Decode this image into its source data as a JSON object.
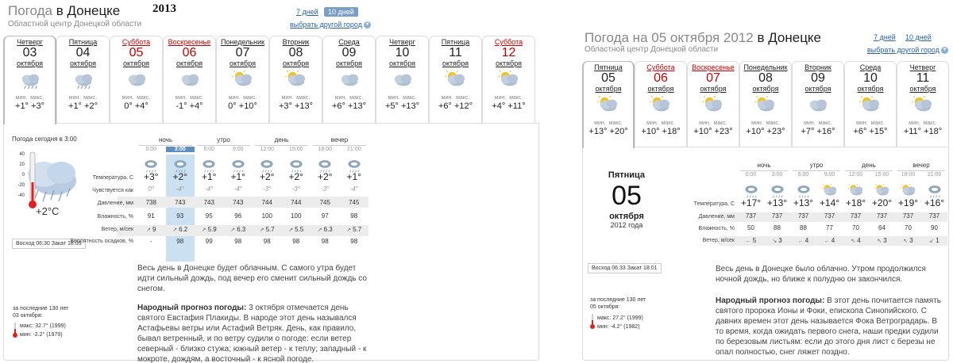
{
  "left": {
    "title_prefix": "Погода ",
    "title_city": "в Донецке",
    "year": "2013",
    "subtitle": "Областной центр Донецкой области",
    "period_7": "7 дней",
    "period_10": "10 дней",
    "other_city": "выбрать другой город",
    "min_label": "мин.",
    "max_label": "макс.",
    "days": [
      {
        "name": "Четверг",
        "num": "03",
        "month": "октября",
        "min": "+1°",
        "max": "+3°",
        "icon": "rain-cloud",
        "weekend": false,
        "selected": true
      },
      {
        "name": "Пятница",
        "num": "04",
        "month": "октября",
        "min": "+1°",
        "max": "+2°",
        "icon": "rain-cloud",
        "weekend": false,
        "selected": false
      },
      {
        "name": "Суббота",
        "num": "05",
        "month": "октября",
        "min": "0°",
        "max": "+4°",
        "icon": "cloud",
        "weekend": true,
        "selected": false
      },
      {
        "name": "Воскресенье",
        "num": "06",
        "month": "октября",
        "min": "-1°",
        "max": "+4°",
        "icon": "cloud",
        "weekend": true,
        "selected": false
      },
      {
        "name": "Понедельник",
        "num": "07",
        "month": "октября",
        "min": "0°",
        "max": "+10°",
        "icon": "sun-cloud",
        "weekend": false,
        "selected": false
      },
      {
        "name": "Вторник",
        "num": "08",
        "month": "октября",
        "min": "+3°",
        "max": "+13°",
        "icon": "sun-cloud",
        "weekend": false,
        "selected": false
      },
      {
        "name": "Среда",
        "num": "09",
        "month": "октября",
        "min": "+6°",
        "max": "+13°",
        "icon": "cloud",
        "weekend": false,
        "selected": false
      },
      {
        "name": "Четверг",
        "num": "10",
        "month": "октября",
        "min": "+5°",
        "max": "+13°",
        "icon": "cloud",
        "weekend": false,
        "selected": false
      },
      {
        "name": "Пятница",
        "num": "11",
        "month": "октября",
        "min": "+6°",
        "max": "+12°",
        "icon": "sun-cloud",
        "weekend": false,
        "selected": false
      },
      {
        "name": "Суббота",
        "num": "12",
        "month": "октября",
        "min": "+4°",
        "max": "+11°",
        "icon": "sun-cloud",
        "weekend": true,
        "selected": false
      }
    ],
    "today_label": "Погода сегодня в 3:00",
    "today_temp": "+2°С",
    "thermo_scale": [
      "40",
      "20",
      "0",
      "-20",
      "-40"
    ],
    "sunrise_label": "Восход",
    "sunrise": "06:30",
    "sunset_label": "Закат",
    "sunset": "18:05",
    "periods": [
      "ночь",
      "утро",
      "день",
      "вечер"
    ],
    "times": [
      "0:00",
      "3:00",
      "6:00",
      "9:00",
      "12:00",
      "15:00",
      "18:00",
      "21:00"
    ],
    "row_labels": [
      "Температура, С",
      "Чувствуется как",
      "Давление, мм",
      "Влажность, %",
      "Ветер, м/сек",
      "Вероятность осадков, %"
    ],
    "hour_icons": [
      "cloud-rain",
      "cloud-rain",
      "cloud-rain",
      "cloud-rain",
      "cloud-rain",
      "cloud-rain",
      "cloud-rain",
      "cloud-rain"
    ],
    "temps": [
      "+3°",
      "+2°",
      "+1°",
      "+1°",
      "+2°",
      "+2°",
      "+2°",
      "+1°"
    ],
    "feels": [
      "0°",
      "-4°",
      "-4°",
      "-4°",
      "-3°",
      "-3°",
      "-3°",
      "-4°"
    ],
    "pressure": [
      "738",
      "743",
      "743",
      "743",
      "744",
      "744",
      "745",
      "745"
    ],
    "humidity": [
      "91",
      "93",
      "95",
      "96",
      "100",
      "100",
      "97",
      "98"
    ],
    "wind_dir": [
      "↗",
      "↗",
      "↗",
      "↗",
      "↗",
      "↗",
      "↗",
      "↗"
    ],
    "wind": [
      "9",
      "6.2",
      "5.9",
      "6.3",
      "5.7",
      "5.5",
      "6.3",
      "5.7"
    ],
    "precip": [
      "-",
      "98",
      "99",
      "98",
      "98",
      "98",
      "98",
      "98"
    ],
    "text1": "Весь день в Донецке будет облачным. С самого утра будет идти сильный дождь, под вечер его сменит сильный дождь со снегом.",
    "hist_label": "за последние 130 лет",
    "hist_date": "03 октября:",
    "hist_max": "макс: 32.7° (1999)",
    "hist_min": "мин: -2.2° (1979)",
    "folk_title": "Народный прогноз погоды:",
    "folk_text": " 3 октября отмечается день святого Евстафия Плакиды. В народе этот день назывался Астафьевы ветры или Астафий Ветряк. День, как правило, бывал ветренный, и по ветру судили о погоде: если ветер северный - близко стужа; южный ветер - к теплу; западный - к мокроте, дождям, а восточный - к ясной погоде."
  },
  "right": {
    "title_prefix": "Погода на 05 октября 2012 ",
    "title_city": "в Донецке",
    "subtitle": "Областной центр Донецкой области",
    "period_7": "7 дней",
    "period_10": "10 дней",
    "other_city": "выбрать другой город",
    "min_label": "мин.",
    "max_label": "макс.",
    "days": [
      {
        "name": "Пятница",
        "num": "05",
        "month": "октября",
        "min": "+13°",
        "max": "+20°",
        "icon": "sun-cloud",
        "weekend": false,
        "selected": true
      },
      {
        "name": "Суббота",
        "num": "06",
        "month": "октября",
        "min": "+10°",
        "max": "+18°",
        "icon": "sun-cloud",
        "weekend": true,
        "selected": false
      },
      {
        "name": "Воскресенье",
        "num": "07",
        "month": "октября",
        "min": "+10°",
        "max": "+23°",
        "icon": "sun-cloud",
        "weekend": true,
        "selected": false
      },
      {
        "name": "Понедельник",
        "num": "08",
        "month": "октября",
        "min": "+10°",
        "max": "+23°",
        "icon": "sun-cloud",
        "weekend": false,
        "selected": false
      },
      {
        "name": "Вторник",
        "num": "09",
        "month": "октября",
        "min": "+7°",
        "max": "+16°",
        "icon": "cloud",
        "weekend": false,
        "selected": false
      },
      {
        "name": "Среда",
        "num": "10",
        "month": "октября",
        "min": "+6°",
        "max": "+15°",
        "icon": "sun-cloud",
        "weekend": false,
        "selected": false
      },
      {
        "name": "Четверг",
        "num": "11",
        "month": "октября",
        "min": "+11°",
        "max": "+18°",
        "icon": "sun-cloud",
        "weekend": false,
        "selected": false
      }
    ],
    "sel_dayname": "Пятница",
    "sel_num": "05",
    "sel_month": "октября",
    "sel_year": "2012 года",
    "sunrise_label": "Восход",
    "sunrise": "06:33",
    "sunset_label": "Закат",
    "sunset": "18:01",
    "periods": [
      "ночь",
      "утро",
      "день",
      "вечер"
    ],
    "times": [
      "0:00",
      "3:00",
      "6:00",
      "9:00",
      "12:00",
      "15:00",
      "18:00",
      "21:00"
    ],
    "row_labels": [
      "Температура, С",
      "Давление, мм",
      "Влажность, %",
      "Ветер, м/сек"
    ],
    "hour_icons": [
      "cloud-rain",
      "cloud-rain",
      "cloud-rain",
      "sun-cloud",
      "sun-cloud",
      "sun-cloud",
      "sun-cloud",
      "cloud-rain"
    ],
    "temps": [
      "+17°",
      "+13°",
      "+13°",
      "+14°",
      "+18°",
      "+20°",
      "+19°",
      "+16°"
    ],
    "pressure": [
      "737",
      "737",
      "737",
      "737",
      "737",
      "737",
      "737",
      "737"
    ],
    "humidity": [
      "50",
      "88",
      "88",
      "77",
      "70",
      "64",
      "70",
      "90"
    ],
    "wind_dir": [
      "←",
      "↘",
      "←",
      "←",
      "↖",
      "↖",
      "↖",
      "↙"
    ],
    "wind": [
      "5",
      "3",
      "4",
      "4",
      "4",
      "3",
      "3",
      "1"
    ],
    "text1": "Весь день в Донецке было облачно. Утром продолжился ночной дождь, но ближе к полудню он закончился.",
    "hist_label": "за последние 130 лет",
    "hist_date": "05 октября:",
    "hist_max": "макс: 27.2° (1999)",
    "hist_min": "мин: -4.2° (1982)",
    "folk_title": "Народный прогноз погоды:",
    "folk_text": " В этот день почитается память святого пророка Ионы и Фоки, епископа Синопийского. С давних времен этот день называется Фока Ветроградарь. В то время, когда ожидать первого снега, наши предки судили по березовым листьям: если до этого дня лист с березы не опал полностью, снег ляжет поздно."
  }
}
